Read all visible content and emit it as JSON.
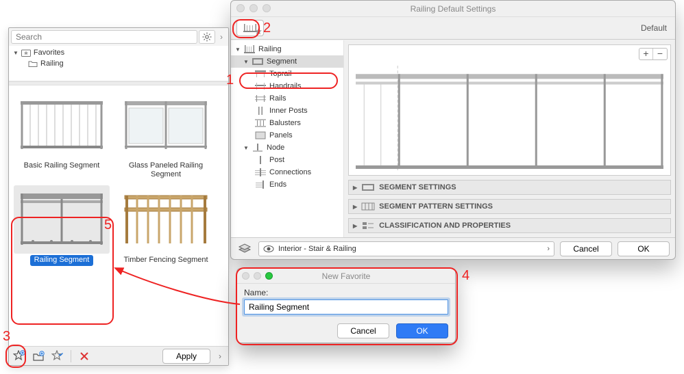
{
  "settings_window": {
    "title": "Railing Default Settings",
    "toolbar": {
      "default_label": "Default"
    },
    "tree": {
      "railing": "Railing",
      "segment": "Segment",
      "toprail": "Toprail",
      "handrails": "Handrails",
      "rails": "Rails",
      "inner_posts": "Inner Posts",
      "balusters": "Balusters",
      "panels": "Panels",
      "node": "Node",
      "post": "Post",
      "connections": "Connections",
      "ends": "Ends"
    },
    "pm": {
      "plus": "+",
      "minus": "−"
    },
    "accordion": {
      "segment_settings": "SEGMENT SETTINGS",
      "segment_pattern": "SEGMENT PATTERN SETTINGS",
      "classification": "CLASSIFICATION AND PROPERTIES"
    },
    "footer": {
      "layer": "Interior - Stair & Railing",
      "cancel": "Cancel",
      "ok": "OK"
    }
  },
  "favorites_panel": {
    "search_placeholder": "Search",
    "tree": {
      "favorites": "Favorites",
      "railing": "Railing"
    },
    "items": [
      {
        "label": "Basic Railing Segment"
      },
      {
        "label": "Glass Paneled Railing Segment"
      },
      {
        "label": "Railing Segment"
      },
      {
        "label": "Timber Fencing Segment"
      }
    ],
    "apply": "Apply"
  },
  "new_favorite_dialog": {
    "title": "New Favorite",
    "name_label": "Name:",
    "name_value": "Railing Segment",
    "cancel": "Cancel",
    "ok": "OK"
  },
  "callouts": {
    "n1": "1",
    "n2": "2",
    "n3": "3",
    "n4": "4",
    "n5": "5"
  }
}
